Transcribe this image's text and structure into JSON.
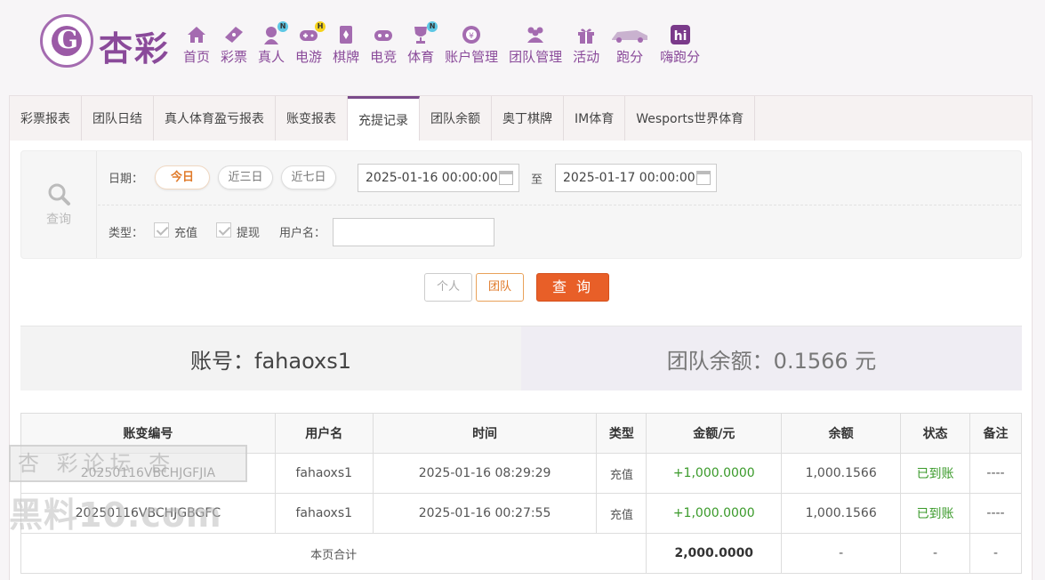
{
  "brand": {
    "logo_text": "杏彩"
  },
  "nav": [
    {
      "label": "首页",
      "icon": "home-icon",
      "badge": ""
    },
    {
      "label": "彩票",
      "icon": "ticket-icon",
      "badge": ""
    },
    {
      "label": "真人",
      "icon": "dealer-icon",
      "badge": "N"
    },
    {
      "label": "电游",
      "icon": "gamepad-icon",
      "badge": "H"
    },
    {
      "label": "棋牌",
      "icon": "cards-icon",
      "badge": ""
    },
    {
      "label": "电竞",
      "icon": "controller-icon",
      "badge": ""
    },
    {
      "label": "体育",
      "icon": "trophy-icon",
      "badge": "N"
    },
    {
      "label": "账户管理",
      "icon": "account-icon",
      "badge": ""
    },
    {
      "label": "团队管理",
      "icon": "team-icon",
      "badge": ""
    },
    {
      "label": "活动",
      "icon": "gift-icon",
      "badge": ""
    },
    {
      "label": "跑分",
      "icon": "car-icon",
      "badge": ""
    },
    {
      "label": "嗨跑分",
      "icon": "hi-icon",
      "badge": ""
    }
  ],
  "tabs": [
    {
      "label": "彩票报表",
      "active": false
    },
    {
      "label": "团队日结",
      "active": false
    },
    {
      "label": "真人体育盈亏报表",
      "active": false
    },
    {
      "label": "账变报表",
      "active": false
    },
    {
      "label": "充提记录",
      "active": true
    },
    {
      "label": "团队余额",
      "active": false
    },
    {
      "label": "奥丁棋牌",
      "active": false
    },
    {
      "label": "IM体育",
      "active": false
    },
    {
      "label": "Wesports世界体育",
      "active": false
    }
  ],
  "filter": {
    "query_label": "查询",
    "date_label": "日期：",
    "quick_dates": [
      "今日",
      "近三日",
      "近七日"
    ],
    "start_date": "2025-01-16 00:00:00",
    "to_label": "至",
    "end_date": "2025-01-17 00:00:00",
    "type_label": "类型：",
    "type_options": [
      "充值",
      "提现"
    ],
    "username_label": "用户名：",
    "username_value": ""
  },
  "buttons": {
    "personal": "个人",
    "team": "团队",
    "query": "查 询"
  },
  "summary": {
    "account": "账号：fahaoxs1",
    "team_balance": "团队余额：0.1566 元"
  },
  "table": {
    "headers": [
      "账变编号",
      "用户名",
      "时间",
      "类型",
      "金额/元",
      "余额",
      "状态",
      "备注"
    ],
    "rows": [
      [
        "20250116VBCHJGFJIA",
        "fahaoxs1",
        "2025-01-16 08:29:29",
        "充值",
        "+1,000.0000",
        "1,000.1566",
        "已到账",
        "----"
      ],
      [
        "20250116VBCHJGBGFC",
        "fahaoxs1",
        "2025-01-16 00:27:55",
        "充值",
        "+1,000.0000",
        "1,000.1566",
        "已到账",
        "----"
      ]
    ],
    "total_label": "本页合计",
    "total_amount": "2,000.0000",
    "total_balance": "-",
    "total_status": "-",
    "total_note": "-"
  },
  "watermark": {
    "line1": "杏 彩论坛 杏",
    "line2": "黑料10.com"
  },
  "colors": {
    "brand_purple": "#8a4a9a",
    "accent_orange": "#e85f28",
    "status_green": "#3a9a2a"
  }
}
